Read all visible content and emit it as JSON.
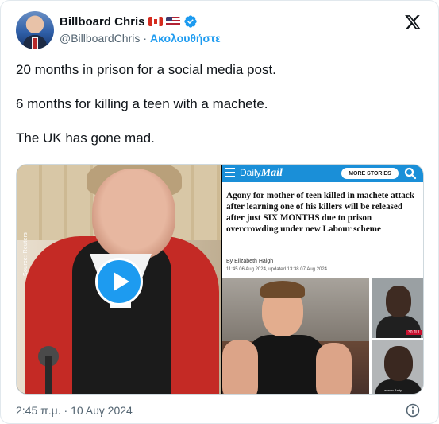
{
  "author": {
    "display_name": "Billboard Chris",
    "handle": "@BillboardChris",
    "separator": "·",
    "follow_label": "Ακολουθήστε",
    "flags": [
      "flag-canada-icon",
      "flag-usa-icon"
    ],
    "verified_icon": "verified-badge-icon"
  },
  "tweet": {
    "lines": [
      "20 months in prison for a social media post.",
      "6 months for killing a teen with a machete.",
      "The UK has gone mad."
    ]
  },
  "media": {
    "video": {
      "source_tag": "Source: Reuters",
      "play_icon": "play-icon"
    },
    "article": {
      "site_prefix": "Daily",
      "site_name": "Mail",
      "more_stories": "MORE STORIES",
      "headline": "Agony for mother of teen killed in machete attack after learning one of his killers will be released after just SIX MONTHS due to prison overcrowding under new Labour scheme",
      "byline": "By Elizabeth Haigh",
      "dateline": "11:45 06 Aug 2024, updated 13:38 07 Aug 2024",
      "photo_tag_1": "30 JUL",
      "photo_tag_2": "Lenaurr Batty"
    }
  },
  "footer": {
    "timestamp": "2:45 π.μ. · 10 Αυγ 2024"
  },
  "colors": {
    "accent": "#1d9bf0",
    "text": "#0f1419",
    "muted": "#536471",
    "dailymail_bar": "#1a8fd8"
  }
}
